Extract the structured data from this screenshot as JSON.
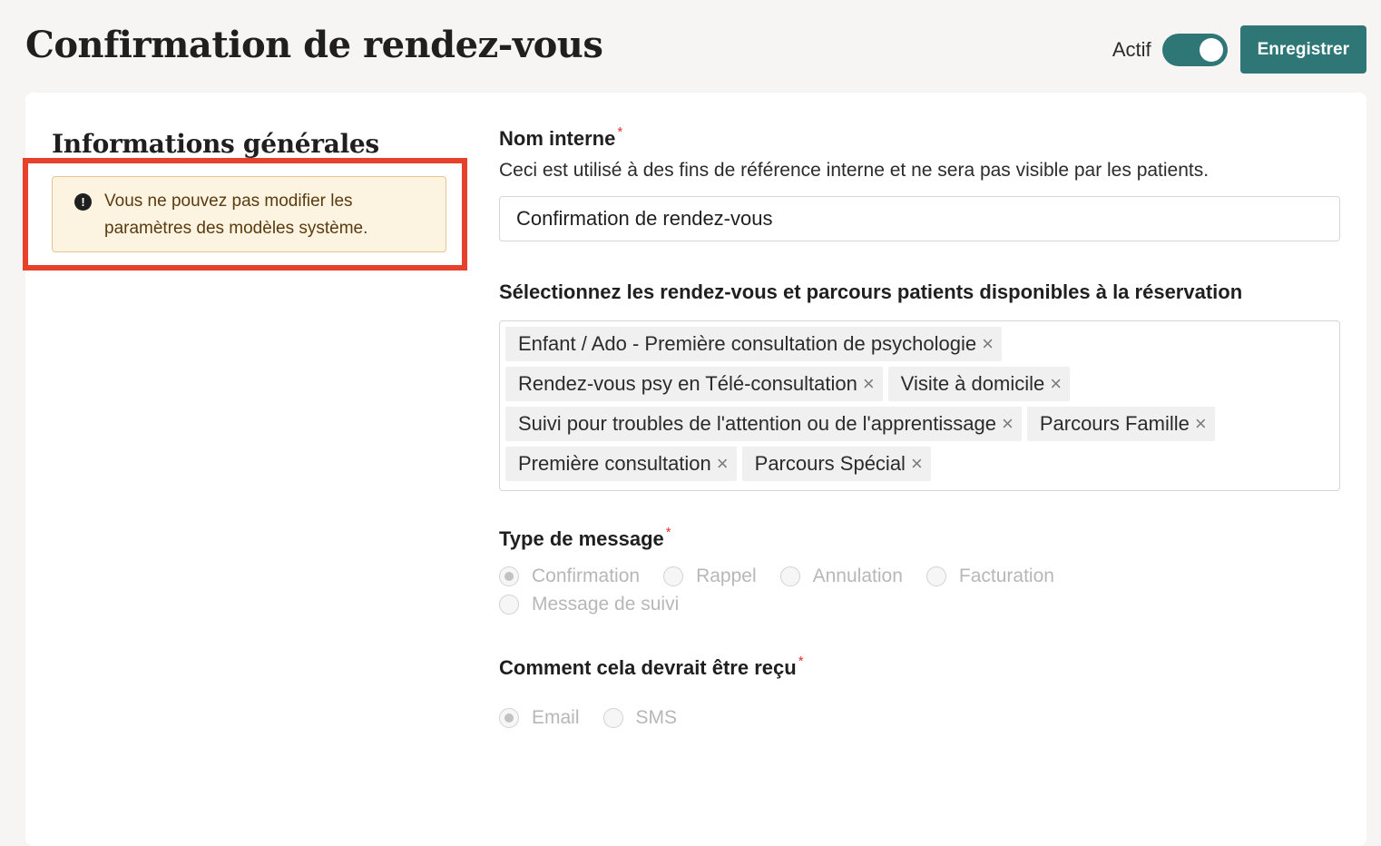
{
  "header": {
    "title": "Confirmation de rendez-vous",
    "active_label": "Actif",
    "active": true,
    "save_label": "Enregistrer"
  },
  "general": {
    "section_title": "Informations générales",
    "warning_text": "Vous ne pouvez pas modifier les paramètres des modèles système."
  },
  "form": {
    "internal_name": {
      "label": "Nom interne",
      "required_mark": "*",
      "help": "Ceci est utilisé à des fins de référence interne et ne sera pas visible par les patients.",
      "value": "Confirmation de rendez-vous"
    },
    "appointments": {
      "label": "Sélectionnez les rendez-vous et parcours patients disponibles à la réservation",
      "tags": [
        "Enfant / Ado - Première consultation de psychologie",
        "Rendez-vous psy en Télé-consultation",
        "Visite à domicile",
        "Suivi pour troubles de l'attention ou de l'apprentissage",
        "Parcours Famille",
        "Première consultation",
        "Parcours Spécial"
      ],
      "remove_symbol": "×"
    },
    "message_type": {
      "label": "Type de message",
      "required_mark": "*",
      "options": [
        "Confirmation",
        "Rappel",
        "Annulation",
        "Facturation",
        "Message de suivi"
      ],
      "selected": "Confirmation"
    },
    "delivery": {
      "label": "Comment cela devrait être reçu",
      "required_mark": "*",
      "options": [
        "Email",
        "SMS"
      ],
      "selected": "Email"
    }
  },
  "colors": {
    "brand": "#2f7777",
    "warning_bg": "#fdf3e1",
    "highlight": "#e8412b",
    "required": "#e0322b"
  }
}
